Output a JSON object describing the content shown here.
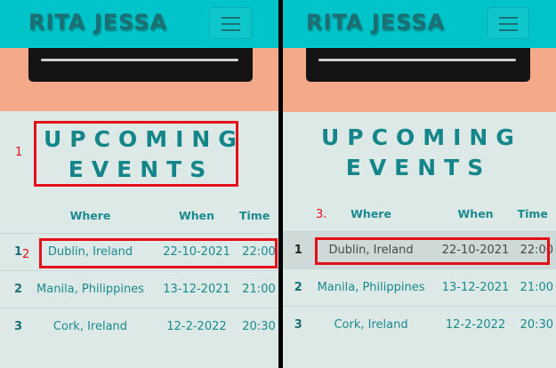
{
  "brand": "RITA JESSA",
  "heading": [
    "UPCOMING",
    "EVENTS"
  ],
  "columns": {
    "number": "",
    "where": "Where",
    "when": "When",
    "time": "Time"
  },
  "events": [
    {
      "num": "1",
      "where": "Dublin, Ireland",
      "when": "22-10-2021",
      "time": "22:00"
    },
    {
      "num": "2",
      "where": "Manila, Philippines",
      "when": "13-12-2021",
      "time": "21:00"
    },
    {
      "num": "3",
      "where": "Cork, Ireland",
      "when": "12-2-2022",
      "time": "20:30"
    }
  ],
  "markers": [
    "1",
    "2",
    "3."
  ],
  "colors": {
    "navbar": "#00c4c9",
    "hero": "#f3a98a",
    "accent": "#14868a",
    "annotation": "#e3101a",
    "page": "#dce9e7"
  }
}
